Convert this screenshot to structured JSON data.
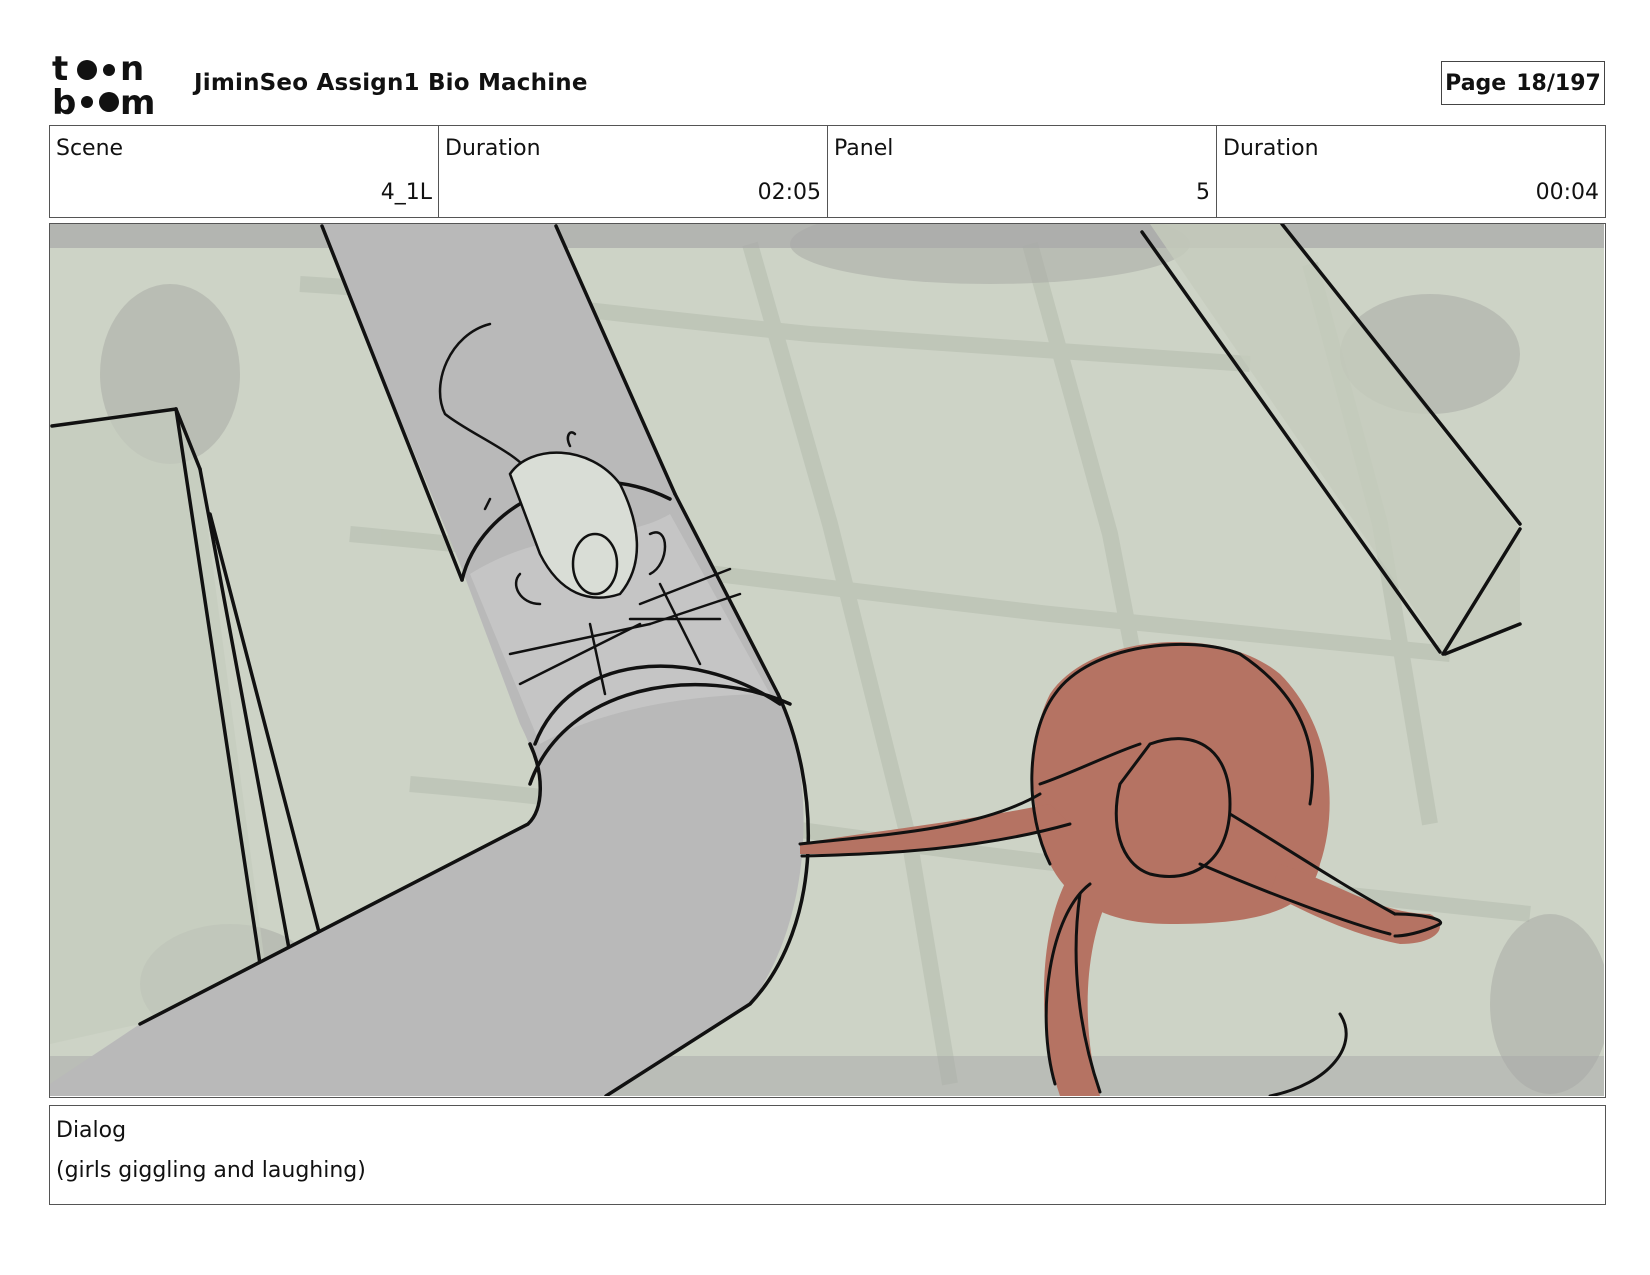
{
  "header": {
    "logo_text_top": "toon",
    "logo_text_bottom": "boom",
    "title": "JiminSeo Assign1 Bio Machine",
    "page_label": "Page",
    "page_number": "18/197"
  },
  "info": {
    "scene_label": "Scene",
    "scene_value": "4_1L",
    "scene_duration_label": "Duration",
    "scene_duration_value": "02:05",
    "panel_label": "Panel",
    "panel_value": "5",
    "panel_duration_label": "Duration",
    "panel_duration_value": "00:04"
  },
  "dialog": {
    "label": "Dialog",
    "text": "(girls giggling and laughing)"
  },
  "colors": {
    "background_green": "#cdd3c6",
    "pipe_gray": "#b8b8b8",
    "character_red": "#b57363",
    "ink": "#111111"
  }
}
